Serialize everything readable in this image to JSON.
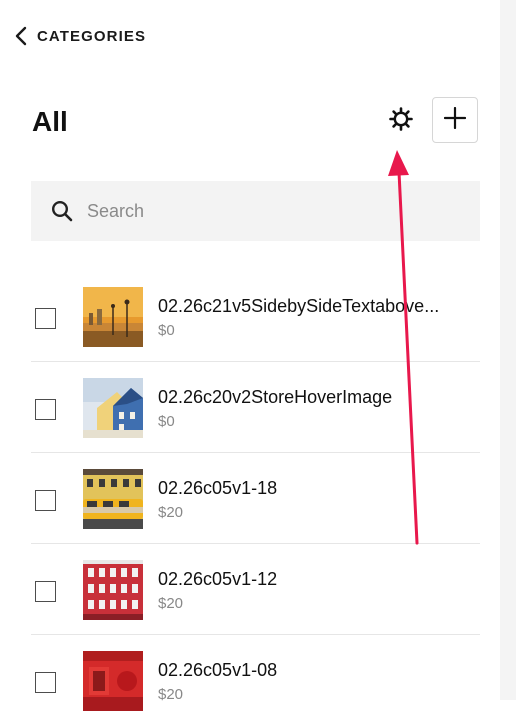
{
  "nav": {
    "back_label": "CATEGORIES"
  },
  "header": {
    "title": "All"
  },
  "search": {
    "placeholder": "Search",
    "value": ""
  },
  "products": [
    {
      "name": "02.26c21v5SidebySideTextabove...",
      "price": "$0"
    },
    {
      "name": "02.26c20v2StoreHoverImage",
      "price": "$0"
    },
    {
      "name": "02.26c05v1-18",
      "price": "$20"
    },
    {
      "name": "02.26c05v1-12",
      "price": "$20"
    },
    {
      "name": "02.26c05v1-08",
      "price": "$20"
    }
  ],
  "colors": {
    "annotation_arrow": "#e8184c",
    "search_bg": "#f3f3f3"
  }
}
